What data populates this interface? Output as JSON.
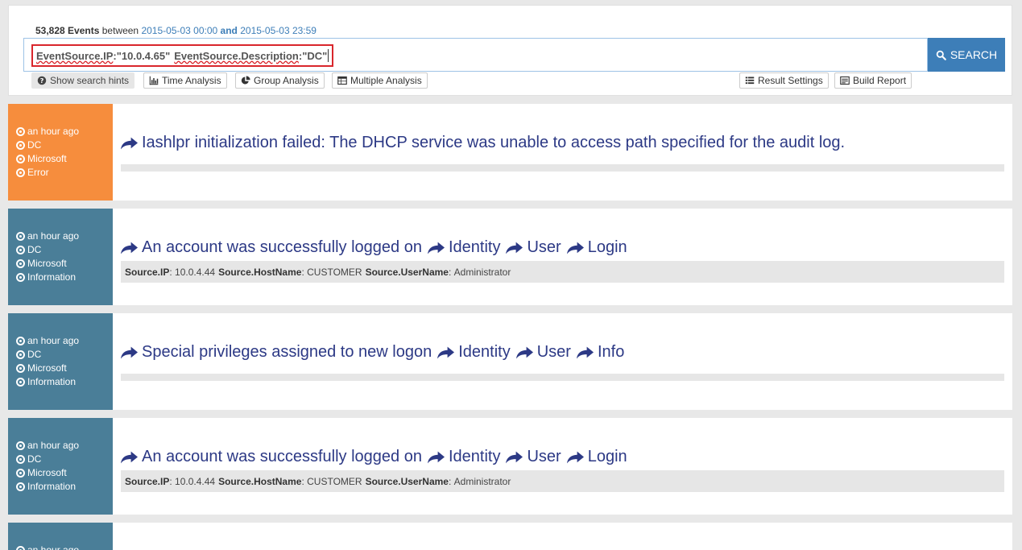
{
  "summary": {
    "count": "53,828 Events",
    "between": "between",
    "start": "2015-05-03 00:00",
    "and": "and",
    "end": "2015-05-03 23:59"
  },
  "search": {
    "field1": "EventSource.IP",
    "value1": "\"10.0.4.65\"",
    "field2": "EventSource.Description",
    "value2": "\"DC\"",
    "button_label": "SEARCH"
  },
  "toolbar": {
    "hints": "Show search hints",
    "time_analysis": "Time Analysis",
    "group_analysis": "Group Analysis",
    "multiple_analysis": "Multiple Analysis",
    "result_settings": "Result Settings",
    "build_report": "Build Report"
  },
  "events": [
    {
      "time": "an hour ago",
      "host": "DC",
      "vendor": "Microsoft",
      "level": "Error",
      "title": [
        "Iashlpr initialization failed: The DHCP service was unable to access path specified for the audit log."
      ],
      "details": null
    },
    {
      "time": "an hour ago",
      "host": "DC",
      "vendor": "Microsoft",
      "level": "Information",
      "title": [
        "An account was successfully logged on",
        "Identity",
        "User",
        "Login"
      ],
      "details": {
        "k1": "Source.IP",
        "v1": "10.0.4.44",
        "k2": "Source.HostName",
        "v2": "CUSTOMER",
        "k3": "Source.UserName",
        "v3": "Administrator"
      }
    },
    {
      "time": "an hour ago",
      "host": "DC",
      "vendor": "Microsoft",
      "level": "Information",
      "title": [
        "Special privileges assigned to new logon",
        "Identity",
        "User",
        "Info"
      ],
      "details": null
    },
    {
      "time": "an hour ago",
      "host": "DC",
      "vendor": "Microsoft",
      "level": "Information",
      "title": [
        "An account was successfully logged on",
        "Identity",
        "User",
        "Login"
      ],
      "details": {
        "k1": "Source.IP",
        "v1": "10.0.4.44",
        "k2": "Source.HostName",
        "v2": "CUSTOMER",
        "k3": "Source.UserName",
        "v3": "Administrator"
      }
    },
    {
      "time": "an hour ago"
    }
  ],
  "colors": {
    "accent": "#3d7eb8",
    "error": "#f68d3d",
    "info": "#4a7e98",
    "title": "#2c3985",
    "highlight_border": "#d9262c"
  }
}
